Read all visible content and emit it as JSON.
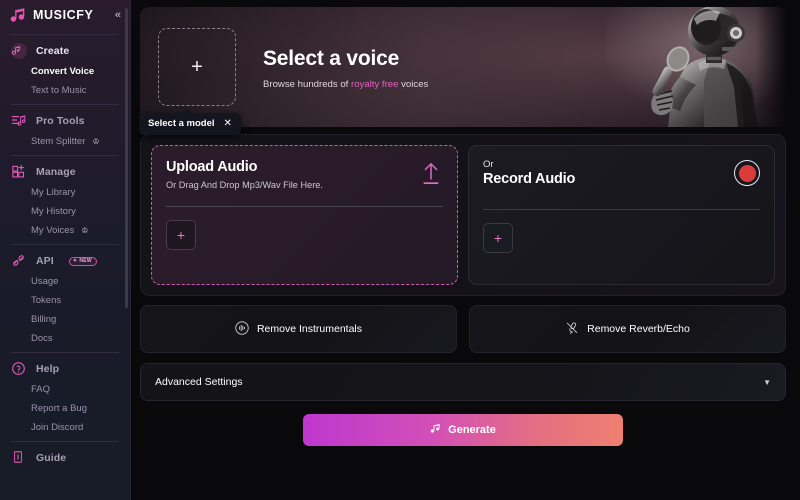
{
  "brand": {
    "name": "MUSICFY",
    "logo_icon": "music-note-icon",
    "collapse_icon": "chevrons-left-icon"
  },
  "sidebar": {
    "groups": [
      {
        "id": "create",
        "label": "Create",
        "icon": "music-note-circle-icon",
        "active": true,
        "items": [
          {
            "label": "Convert Voice",
            "active": true,
            "crown": false
          },
          {
            "label": "Text to Music",
            "active": false,
            "crown": false
          }
        ]
      },
      {
        "id": "pro-tools",
        "label": "Pro Tools",
        "icon": "equalizer-note-icon",
        "active": false,
        "items": [
          {
            "label": "Stem Splitter",
            "active": false,
            "crown": true
          }
        ]
      },
      {
        "id": "manage",
        "label": "Manage",
        "icon": "grid-plus-icon",
        "active": false,
        "items": [
          {
            "label": "My Library",
            "active": false,
            "crown": false
          },
          {
            "label": "My History",
            "active": false,
            "crown": false
          },
          {
            "label": "My Voices",
            "active": false,
            "crown": true
          }
        ]
      },
      {
        "id": "api",
        "label": "API",
        "icon": "api-link-icon",
        "badge": "NEW",
        "badge_spark": "✦",
        "active": false,
        "items": [
          {
            "label": "Usage",
            "active": false,
            "crown": false
          },
          {
            "label": "Tokens",
            "active": false,
            "crown": false
          },
          {
            "label": "Billing",
            "active": false,
            "crown": false
          },
          {
            "label": "Docs",
            "active": false,
            "crown": false
          }
        ]
      },
      {
        "id": "help",
        "label": "Help",
        "icon": "question-circle-icon",
        "active": false,
        "items": [
          {
            "label": "FAQ",
            "active": false,
            "crown": false
          },
          {
            "label": "Report a Bug",
            "active": false,
            "crown": false
          },
          {
            "label": "Join Discord",
            "active": false,
            "crown": false
          }
        ]
      },
      {
        "id": "guide",
        "label": "Guide",
        "icon": "book-icon",
        "active": false,
        "items": []
      }
    ]
  },
  "hero": {
    "plus_icon": "plus-icon",
    "title": "Select a voice",
    "subtitle_prefix": "Browse hundreds of ",
    "subtitle_highlight": "royalty free",
    "subtitle_suffix": " voices",
    "highlight_color": "#e05fc0",
    "robot_image": "robot-singer-image"
  },
  "tooltip": {
    "label": "Select a model",
    "close_icon": "close-icon"
  },
  "upload_card": {
    "title": "Upload Audio",
    "subtitle": "Or Drag And Drop Mp3/Wav File Here.",
    "upload_icon": "upload-arrow-icon",
    "add_icon": "plus-icon",
    "border_color": "#c95bb4"
  },
  "record_card": {
    "eyebrow": "Or",
    "title": "Record Audio",
    "record_icon": "record-dot-icon",
    "record_color": "#dc3b3b",
    "add_icon": "plus-icon"
  },
  "tools": [
    {
      "label": "Remove Instrumentals",
      "icon": "waveform-circle-icon"
    },
    {
      "label": "Remove Reverb/Echo",
      "icon": "mic-muted-icon"
    }
  ],
  "advanced": {
    "label": "Advanced Settings",
    "caret_icon": "chevron-down-icon"
  },
  "generate": {
    "label": "Generate",
    "icon": "headphones-icon",
    "gradient_start": "#bf37cf",
    "gradient_end": "#ef7f71"
  }
}
